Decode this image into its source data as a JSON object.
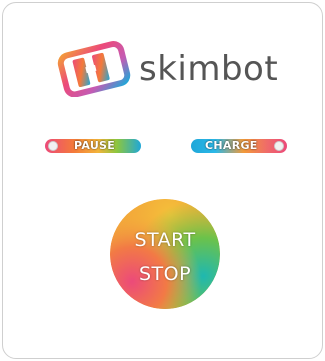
{
  "brand": {
    "name": "skimbot",
    "icon": "skimbot-logo-icon",
    "colors": {
      "pink": "#ec4a7a",
      "orange": "#f47a3a",
      "yellow": "#f3b43b",
      "green": "#8cc63f",
      "blue": "#1fa7d8",
      "text": "#555555"
    }
  },
  "controls": {
    "pause_label": "PAUSE",
    "charge_label": "CHARGE",
    "start_stop_line1": "START",
    "start_stop_line2": "STOP"
  }
}
